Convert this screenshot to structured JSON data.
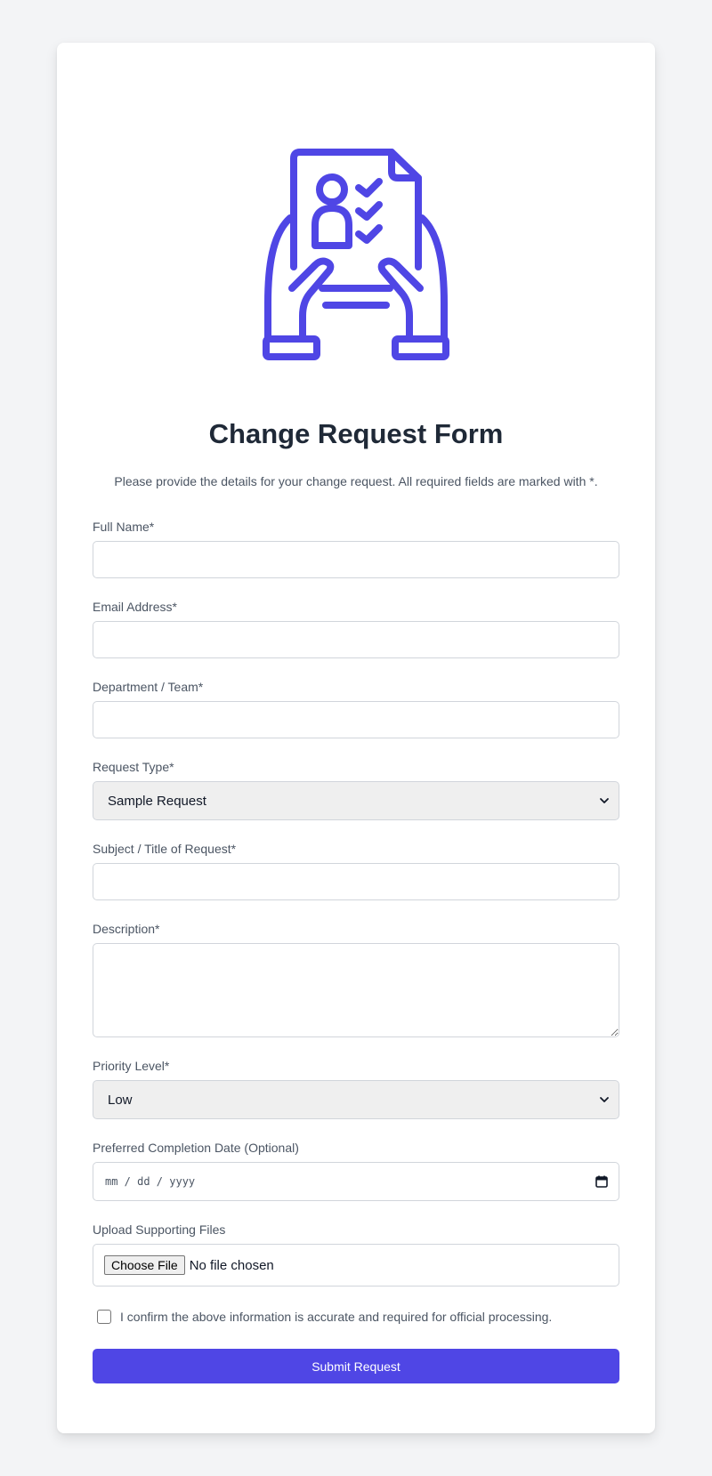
{
  "form": {
    "title": "Change Request Form",
    "subtitle": "Please provide the details for your change request. All required fields are marked with *.",
    "hero_icon": "document-hands-checklist-icon",
    "accent_color": "#4f46e5",
    "fields": {
      "full_name": {
        "label": "Full Name*",
        "value": ""
      },
      "email": {
        "label": "Email Address*",
        "value": ""
      },
      "department": {
        "label": "Department / Team*",
        "value": ""
      },
      "request_type": {
        "label": "Request Type*",
        "selected": "Sample Request"
      },
      "subject": {
        "label": "Subject / Title of Request*",
        "value": ""
      },
      "description": {
        "label": "Description*",
        "value": ""
      },
      "priority": {
        "label": "Priority Level*",
        "selected": "Low"
      },
      "completion_date": {
        "label": "Preferred Completion Date (Optional)",
        "placeholder": "mm / dd / yyyy"
      },
      "upload": {
        "label": "Upload Supporting Files",
        "button_label": "Choose File",
        "status": "No file chosen"
      }
    },
    "confirm_label": "I confirm the above information is accurate and required for official processing.",
    "confirm_checked": false,
    "submit_label": "Submit Request"
  }
}
